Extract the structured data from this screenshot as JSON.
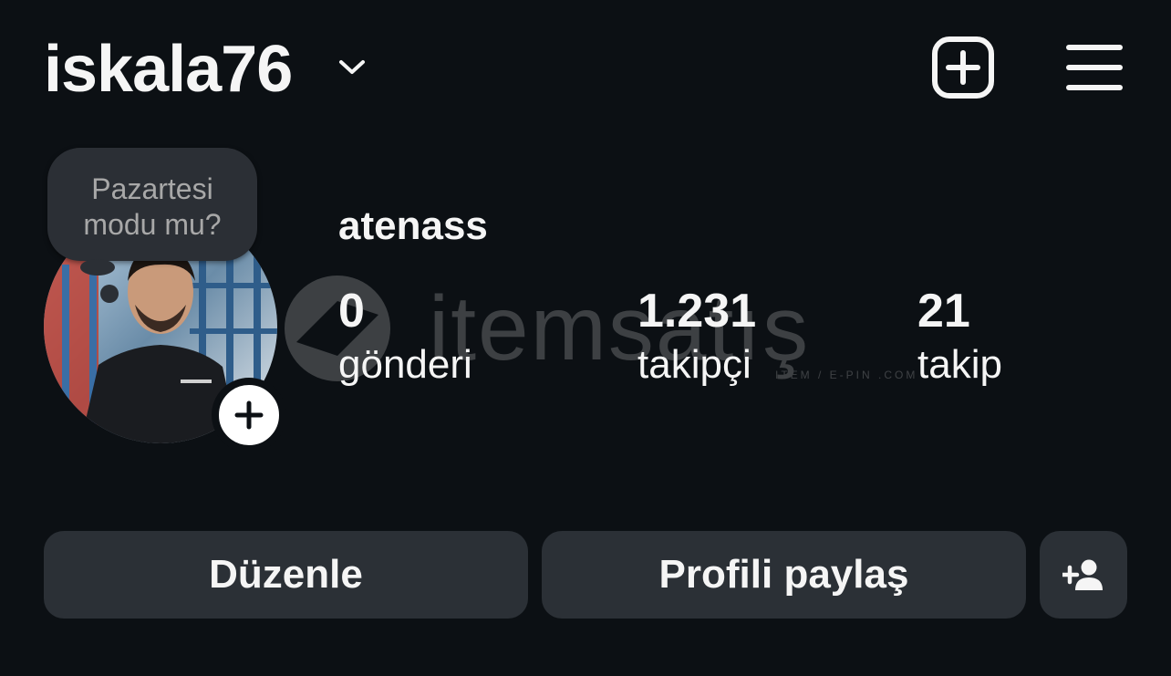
{
  "header": {
    "username": "iskala76",
    "chevron_icon": "chevron-down-icon",
    "new_post_icon": "plus-square-icon",
    "menu_icon": "hamburger-menu-icon"
  },
  "note": {
    "text": "Pazartesi\nmodu mu?"
  },
  "profile": {
    "display_name": "atenass",
    "stats": {
      "posts": {
        "count": "0",
        "label": "gönderi"
      },
      "followers": {
        "count": "1.231",
        "label": "takipçi"
      },
      "following": {
        "count": "21",
        "label": "takip"
      }
    }
  },
  "watermark": {
    "brand": "itemsatış",
    "sub": "ITEM / E-PIN .COM"
  },
  "actions": {
    "edit_label": "Düzenle",
    "share_label": "Profili paylaş",
    "discover_icon": "add-person-icon"
  },
  "colors": {
    "background": "#0c1014",
    "button_bg": "#2b3036",
    "text": "#f5f5f5",
    "muted_text": "#a8a8a8"
  }
}
